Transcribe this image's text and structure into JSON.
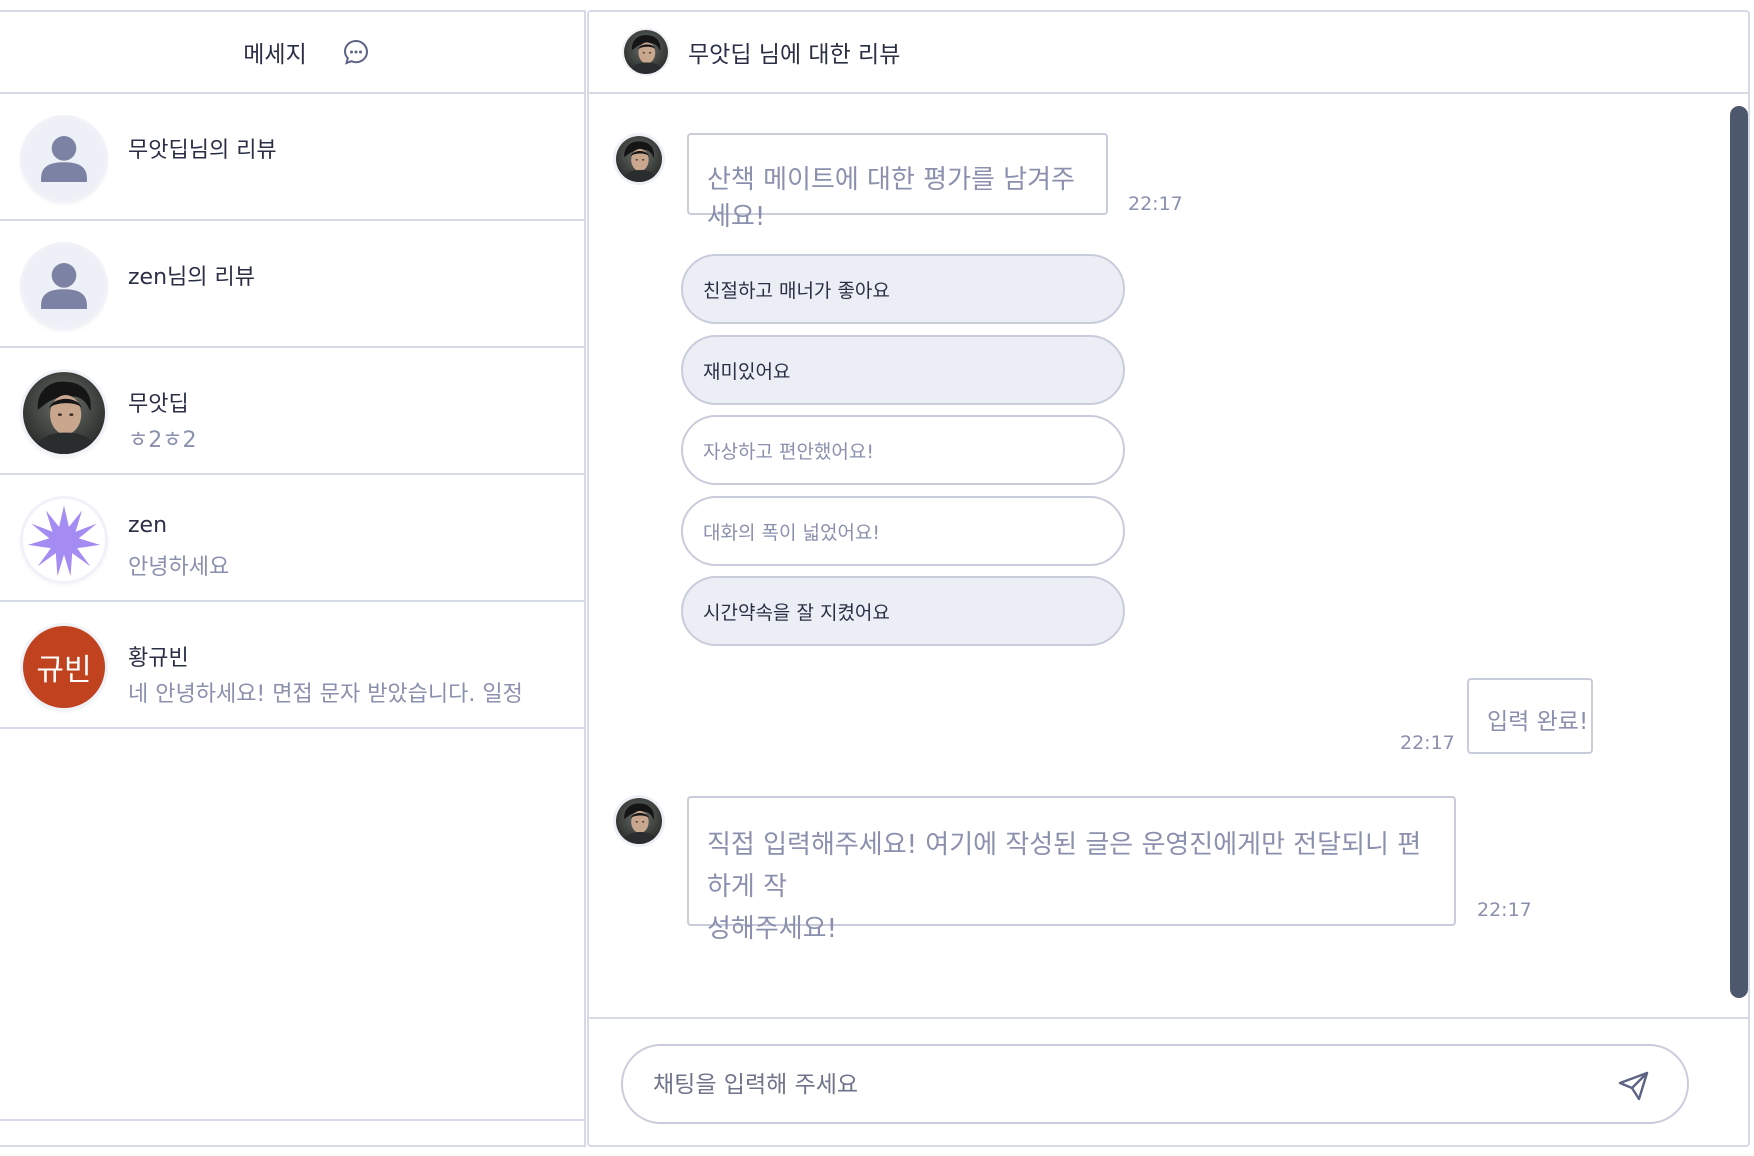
{
  "sidebar": {
    "title": "메세지",
    "conversations": [
      {
        "name": "무앗딥님의 리뷰",
        "preview": "",
        "avatar": "default-person"
      },
      {
        "name": "zen님의 리뷰",
        "preview": "",
        "avatar": "default-person"
      },
      {
        "name": "무앗딥",
        "preview": "ㅎ2ㅎ2",
        "avatar": "photo"
      },
      {
        "name": "zen",
        "preview": "안녕하세요",
        "avatar": "purple-starburst"
      },
      {
        "name": "황규빈",
        "preview": "네 안녕하세요! 면접 문자 받았습니다. 일정",
        "avatar": "규빈"
      }
    ]
  },
  "chat": {
    "title": "무앗딥 님에 대한 리뷰",
    "messages": [
      {
        "text": "산책 메이트에 대한 평가를 남겨주세요!",
        "time": "22:17"
      },
      {
        "text": "입력 완료!",
        "time": "22:17"
      },
      {
        "text": "직접 입력해주세요! 여기에 작성된 글은 운영진에게만 전달되니 편하게 작",
        "text2": "성해주세요!",
        "time": "22:17"
      }
    ],
    "options": [
      {
        "label": "친절하고 매너가 좋아요",
        "selected": true
      },
      {
        "label": "재미있어요",
        "selected": true
      },
      {
        "label": "자상하고 편안했어요!",
        "selected": false
      },
      {
        "label": "대화의 폭이 넓었어요!",
        "selected": false
      },
      {
        "label": "시간약속을 잘 지켰어요",
        "selected": true
      }
    ]
  },
  "input": {
    "placeholder": "채팅을 입력해 주세요"
  },
  "colors": {
    "border": "#d6d9e6",
    "text_dark": "#2a2f45",
    "text_muted": "#8a90ad",
    "selected_fill": "#eceef5",
    "scrollbar": "#4e586d",
    "avatar_red": "#c0421e",
    "avatar_purple": "#a58cf2"
  },
  "icons": {
    "header": "chat-bubble-icon",
    "send": "paper-plane-icon",
    "default_avatar": "person-icon"
  }
}
